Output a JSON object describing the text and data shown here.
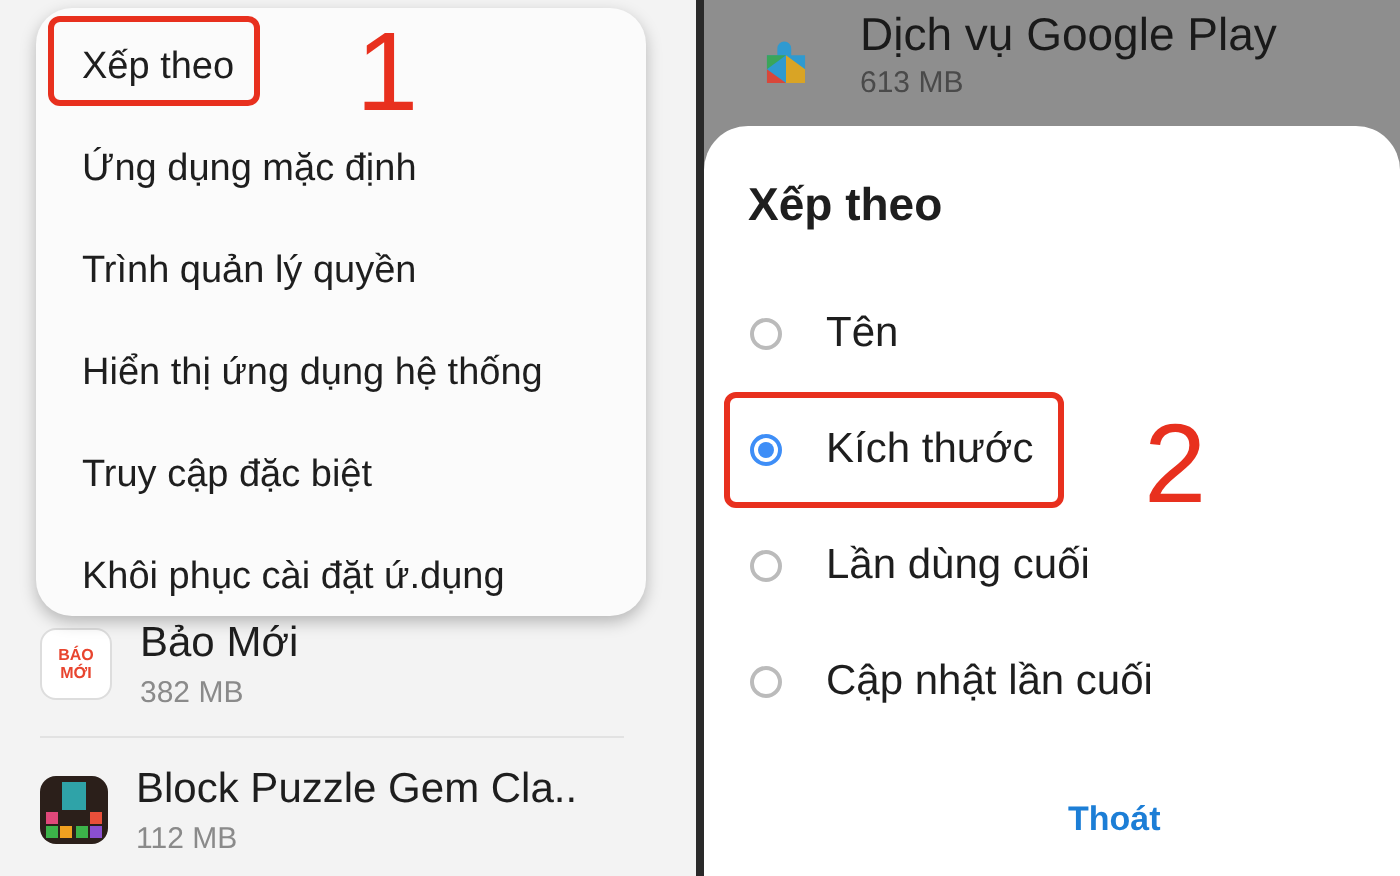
{
  "left_screen": {
    "menu": {
      "items": [
        {
          "label": "Xếp theo",
          "highlighted": true
        },
        {
          "label": "Ứng dụng mặc định",
          "highlighted": false
        },
        {
          "label": "Trình quản lý quyền",
          "highlighted": false
        },
        {
          "label": "Hiển thị ứng dụng hệ thống",
          "highlighted": false
        },
        {
          "label": "Truy cập đặc biệt",
          "highlighted": false
        },
        {
          "label": "Khôi phục cài đặt ứ.dụng",
          "highlighted": false
        }
      ]
    },
    "apps": [
      {
        "kind": "news",
        "name": "Bảo Mới",
        "size": "382 MB",
        "icon_text": [
          "BÁO",
          "MỚI"
        ]
      },
      {
        "kind": "puzzle",
        "name": "Block Puzzle Gem Cla..",
        "size": "112 MB"
      }
    ],
    "step_number": "1"
  },
  "right_screen": {
    "background_app": {
      "name": "Dịch vụ Google Play",
      "size": "613 MB"
    },
    "dialog": {
      "title": "Xếp theo",
      "options": [
        {
          "label": "Tên",
          "selected": false,
          "highlighted": false
        },
        {
          "label": "Kích thước",
          "selected": true,
          "highlighted": true
        },
        {
          "label": "Lần dùng cuối",
          "selected": false,
          "highlighted": false
        },
        {
          "label": "Cập nhật lần cuối",
          "selected": false,
          "highlighted": false
        }
      ],
      "cancel_button": "Thoát"
    },
    "step_number": "2"
  }
}
